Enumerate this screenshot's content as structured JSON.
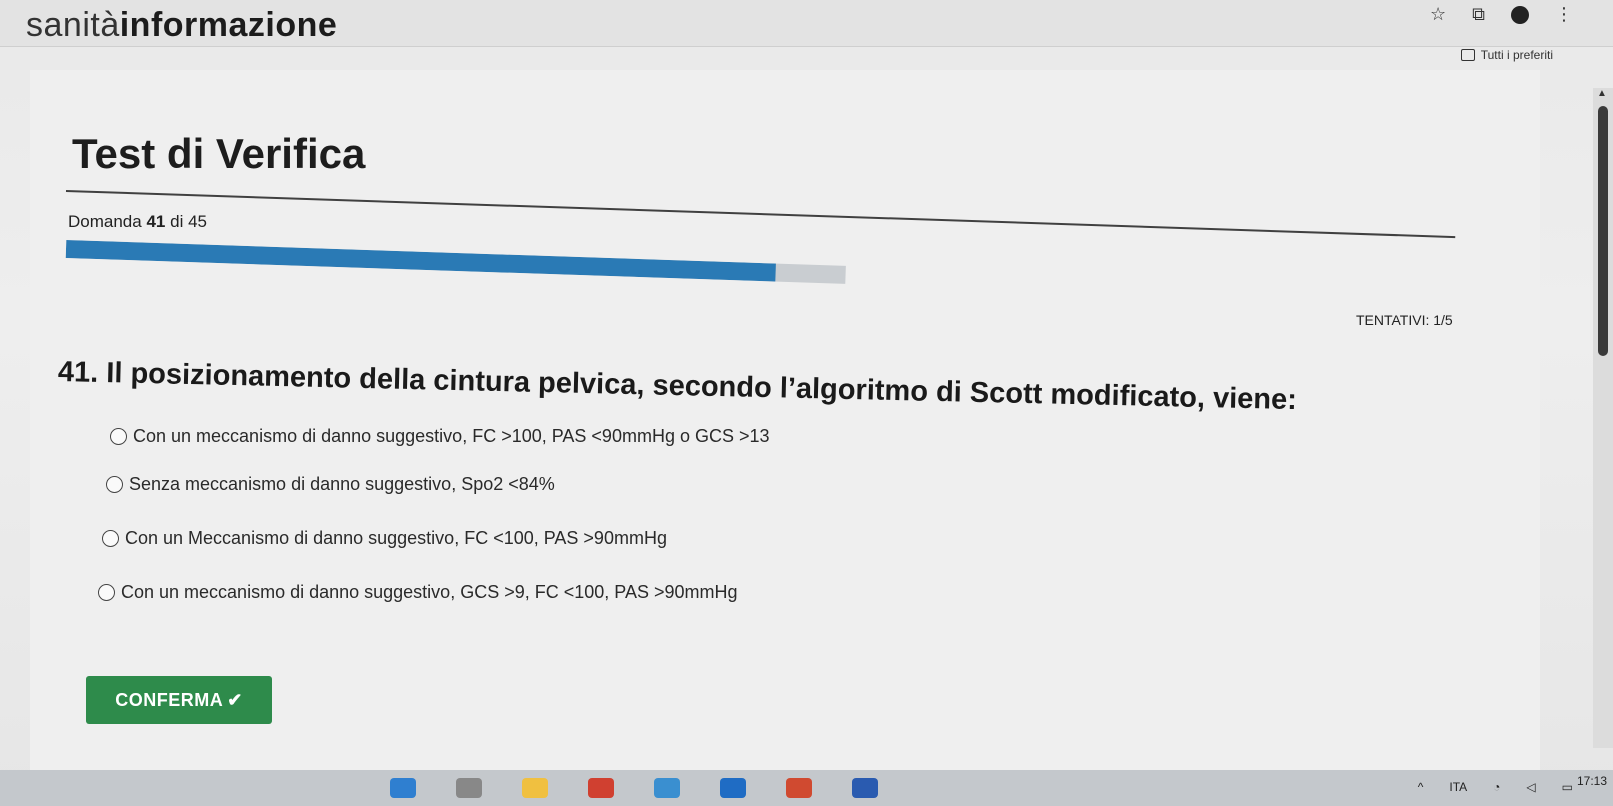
{
  "header": {
    "brand_faded": "sanità",
    "brand_bold": "informazione"
  },
  "bookmarks": {
    "label": "Tutti i preferiti"
  },
  "test": {
    "title": "Test di Verifica",
    "counter_prefix": "Domanda",
    "counter_current": "41",
    "counter_sep": "di",
    "counter_total": "45",
    "progress_fraction": 0.91,
    "attempts": "TENTATIVI: 1/5"
  },
  "question": {
    "text": "41. Il posizionamento della cintura pelvica, secondo l’algoritmo di Scott modificato, viene:",
    "options": [
      "Con un meccanismo di danno suggestivo, FC >100, PAS <90mmHg o GCS >13",
      "Senza meccanismo di danno suggestivo, Spo2 <84%",
      "Con un Meccanismo di danno suggestivo, FC <100, PAS >90mmHg",
      "Con un meccanismo di danno suggestivo, GCS >9, FC <100, PAS >90mmHg"
    ]
  },
  "actions": {
    "confirm_label": "CONFERMA",
    "confirm_icon": "✔"
  },
  "taskbar": {
    "lang": "ITA",
    "time": "17:13",
    "icons": [
      {
        "name": "start",
        "color": "#2f7fd0"
      },
      {
        "name": "search",
        "color": "#888888"
      },
      {
        "name": "files",
        "color": "#f0c040"
      },
      {
        "name": "chrome",
        "color": "#d04030"
      },
      {
        "name": "store",
        "color": "#3a8fd0"
      },
      {
        "name": "outlook",
        "color": "#1f6cc4"
      },
      {
        "name": "powerpoint",
        "color": "#d04a30"
      },
      {
        "name": "word",
        "color": "#2a5bb0"
      }
    ]
  },
  "colors": {
    "progress": "#2a7ab5",
    "confirm": "#2e8b4b"
  }
}
